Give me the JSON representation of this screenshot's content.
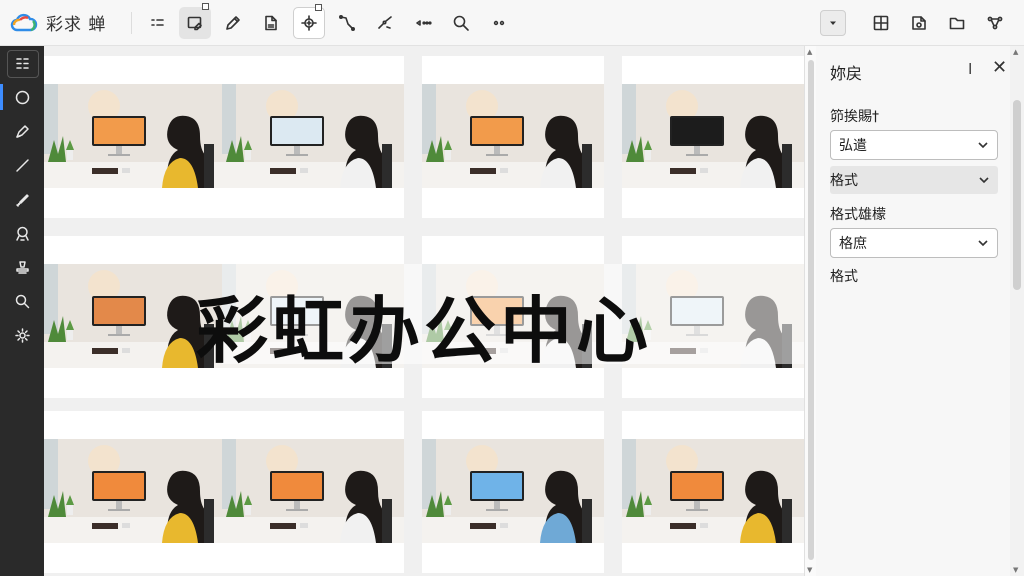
{
  "app": {
    "title": "彩求 蝉"
  },
  "colors": {
    "toolbar_bg": "#f7f7f7",
    "sidebar_bg": "#2a2a2a",
    "accent": "#3d8cff",
    "panel_bg": "#f7f7f7"
  },
  "toolbar": {
    "tools": [
      "list-icon",
      "frame-edit-icon",
      "pencil-icon",
      "document-icon",
      "transform-icon",
      "path-icon",
      "scatter-icon",
      "dots-arrow-icon",
      "search-icon",
      "more-icon"
    ],
    "right_tools": [
      "dropdown-icon",
      "grid-icon",
      "page-icon",
      "folder-icon",
      "share-icon"
    ]
  },
  "sidebar": {
    "tools": [
      "layers-icon",
      "ellipse-icon",
      "pen-icon",
      "line-icon",
      "brush-icon",
      "lasso-icon",
      "stamp-icon",
      "zoom-icon",
      "settings-icon"
    ]
  },
  "canvas": {
    "watermark": "彩虹办公中心",
    "thumbnail_count": 12
  },
  "panel": {
    "title": "妳戻",
    "pin": "I",
    "close": "✕",
    "label_1": "笷挨賜†",
    "select_1": "弘遣",
    "row_1": "格式",
    "label_2": "格式雄檬",
    "select_2": "格庶",
    "label_3": "格式"
  }
}
